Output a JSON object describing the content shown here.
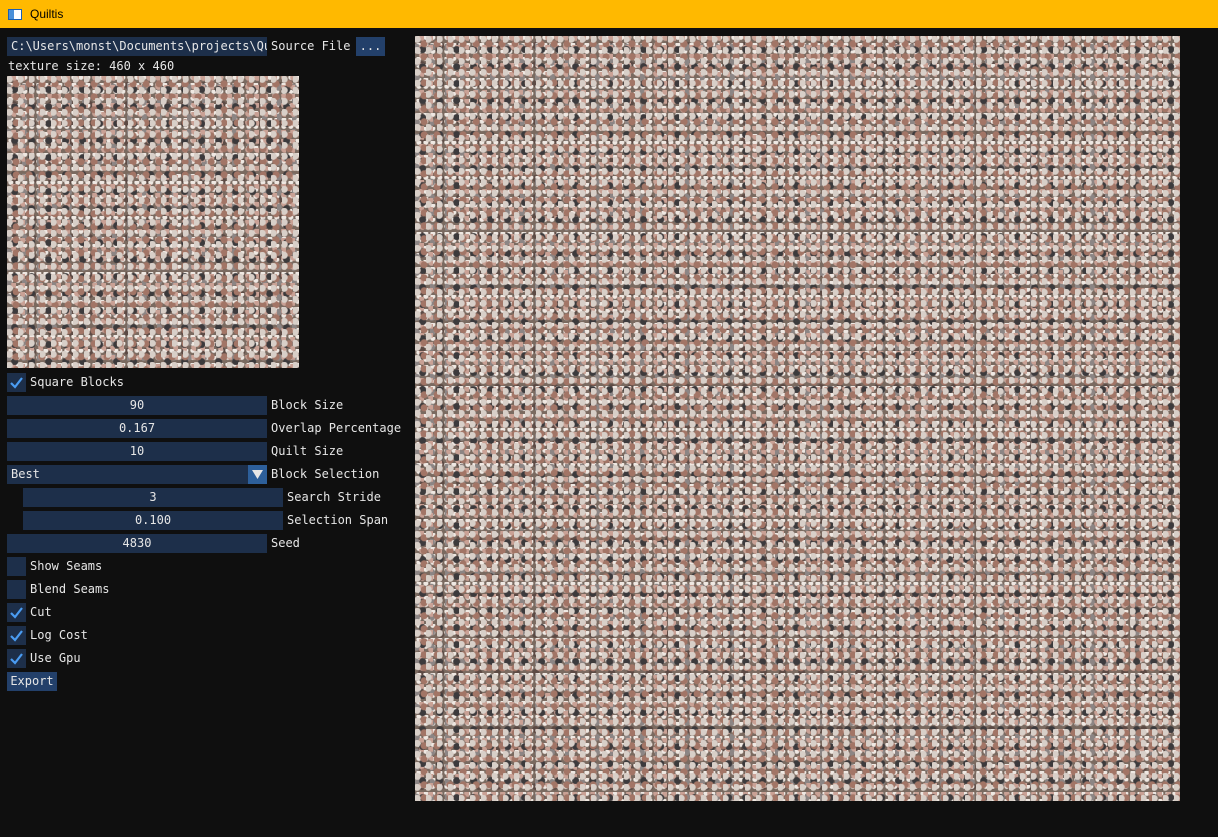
{
  "window": {
    "title": "Quiltis"
  },
  "source": {
    "path": "C:\\Users\\monst\\Documents\\projects\\Qui",
    "label": "Source File",
    "browse_label": "...",
    "texture_size": "texture size: 460 x 460"
  },
  "controls": {
    "square_blocks": {
      "label": "Square Blocks",
      "checked": true
    },
    "block_size": {
      "value": "90",
      "label": "Block Size"
    },
    "overlap_percentage": {
      "value": "0.167",
      "label": "Overlap Percentage"
    },
    "quilt_size": {
      "value": "10",
      "label": "Quilt Size"
    },
    "block_selection": {
      "value": "Best",
      "label": "Block Selection"
    },
    "search_stride": {
      "value": "3",
      "label": "Search Stride"
    },
    "selection_span": {
      "value": "0.100",
      "label": "Selection Span"
    },
    "seed": {
      "value": "4830",
      "label": "Seed"
    },
    "show_seams": {
      "label": "Show Seams",
      "checked": false
    },
    "blend_seams": {
      "label": "Blend Seams",
      "checked": false
    },
    "cut": {
      "label": "Cut",
      "checked": true
    },
    "log_cost": {
      "label": "Log Cost",
      "checked": true
    },
    "use_gpu": {
      "label": "Use Gpu",
      "checked": true
    },
    "export_label": "Export"
  },
  "colors": {
    "titlebar": "#ffb900",
    "frame": "#1d2f4a",
    "button": "#23406a",
    "check": "#4a9cf2",
    "background": "#0f0f0f"
  }
}
